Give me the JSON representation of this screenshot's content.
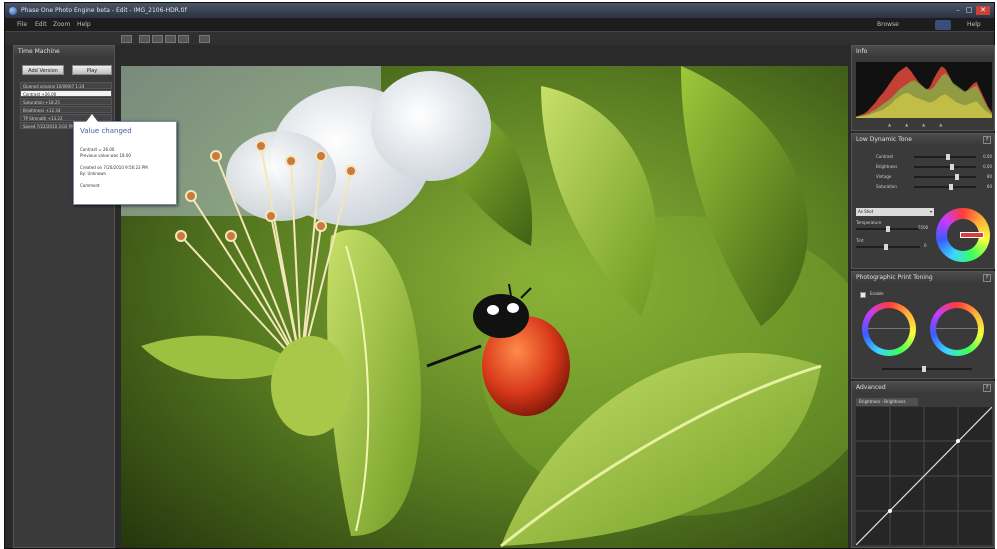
{
  "window": {
    "title": "Phase One Photo Engine beta - Edit - IMG_2106-HDR.tif"
  },
  "menu": [
    "File",
    "Edit",
    "Zoom",
    "Help"
  ],
  "menu_right": {
    "browse": "Browse",
    "help": "Help"
  },
  "time_machine": {
    "title": "Time Machine",
    "add_version_label": "Add Version",
    "play_label": "Play",
    "history": [
      "Opened original 10/09/07 1:24",
      "Contrast +26.00",
      "Saturation +18.25",
      "Brightness +12.34",
      "TP Strength +13.22",
      "Saved 7/22/2010 3:02 PM"
    ],
    "selected_index": 1
  },
  "tooltip": {
    "title": "Value changed",
    "lines": [
      "Contrast = 26.00",
      "Previous value was 18.00",
      "",
      "Created on 7/20/2010 9:56:23 PM",
      "By: Unknown",
      "",
      "Comment"
    ]
  },
  "info": {
    "title": "Info",
    "histogram_red": [
      2,
      4,
      6,
      10,
      16,
      22,
      30,
      36,
      44,
      52,
      60,
      66,
      70,
      74,
      68,
      60,
      52,
      46,
      40,
      44,
      56,
      66,
      74,
      70,
      60,
      48,
      44,
      40,
      36,
      42,
      48,
      52,
      40,
      28,
      16,
      8
    ],
    "histogram_green": [
      2,
      3,
      4,
      6,
      9,
      12,
      16,
      20,
      24,
      28,
      34,
      40,
      44,
      48,
      52,
      54,
      50,
      46,
      42,
      40,
      44,
      52,
      60,
      64,
      58,
      50,
      46,
      42,
      38,
      40,
      44,
      46,
      36,
      24,
      14,
      6
    ],
    "histogram_blue": [
      1,
      2,
      3,
      4,
      6,
      8,
      10,
      12,
      16,
      20,
      26,
      30,
      34,
      36,
      34,
      30,
      28,
      26,
      24,
      22,
      24,
      28,
      32,
      34,
      30,
      26,
      22,
      20,
      18,
      20,
      22,
      24,
      18,
      12,
      8,
      4
    ]
  },
  "ldt": {
    "title": "Low Dynamic Tone",
    "sliders": [
      {
        "label": "Contrast",
        "value": "0.00",
        "pos": 0.55
      },
      {
        "label": "Brightness",
        "value": "0.00",
        "pos": 0.62
      },
      {
        "label": "Vintage",
        "value": "80",
        "pos": 0.7
      },
      {
        "label": "Saturation",
        "value": "60",
        "pos": 0.6
      }
    ],
    "mode_label": "As Shot",
    "temp_label": "Temperature",
    "temp_value": "5500",
    "tint_label": "Tint",
    "tint_value": "0"
  },
  "ppt": {
    "title": "Photographic Print Toning",
    "enable_label": "Enable"
  },
  "advanced": {
    "title": "Advanced",
    "curve_tab": "Brightness - Brightness"
  },
  "colors": {
    "accent_blue": "#3f62a5",
    "hist_red": "#e24a3b",
    "hist_green": "#7cc24a",
    "hist_yellow": "#e3d44a"
  }
}
